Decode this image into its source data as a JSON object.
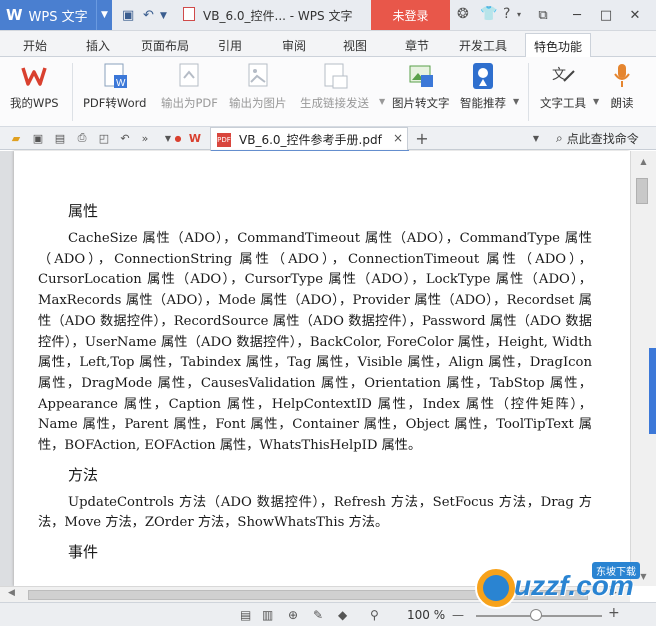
{
  "app": {
    "logo": "W",
    "name": "WPS 文字",
    "dropdown": "▼"
  },
  "window": {
    "title": "VB_6.0_控件... - WPS 文字",
    "login": "未登录",
    "controls": {
      "restore": "⧉",
      "minimize": "─",
      "maximize": "□",
      "close": "✕"
    }
  },
  "tabs": [
    "开始",
    "插入",
    "页面布局",
    "引用",
    "审阅",
    "视图",
    "章节",
    "开发工具",
    "特色功能"
  ],
  "active_tab": "特色功能",
  "ribbon": {
    "my_wps": "我的WPS",
    "pdf_to_word": "PDF转Word",
    "export_pdf": "输出为PDF",
    "export_image": "输出为图片",
    "gen_link": "生成链接发送",
    "image_to_text": "图片转文字",
    "smart_recommend": "智能推荐",
    "text_tools": "文字工具",
    "read_aloud": "朗读"
  },
  "doc_tab": {
    "name": "VB_6.0_控件参考手册.pdf",
    "close": "×",
    "add": "+"
  },
  "search_cmd": "点此查找命令",
  "document": {
    "sections": [
      {
        "heading": "属性",
        "text": "CacheSize 属性（ADO），CommandTimeout 属性（ADO），CommandType 属性（ADO），ConnectionString 属性（ADO），ConnectionTimeout 属性（ADO），CursorLocation 属性（ADO），CursorType 属性（ADO），LockType 属性（ADO），MaxRecords 属性（ADO），Mode 属性（ADO），Provider 属性（ADO），Recordset 属性（ADO 数据控件），RecordSource 属性（ADO 数据控件），Password 属性（ADO 数据控件），UserName 属性（ADO 数据控件），BackColor, ForeColor 属性，Height, Width 属性，Left,Top 属性，Tabindex 属性，Tag 属性，Visible 属性，Align 属性，DragIcon 属性，DragMode 属性，CausesValidation 属性，Orientation 属性，TabStop 属性，Appearance 属性，Caption 属性，HelpContextID 属性，Index 属性（控件矩阵），Name 属性，Parent 属性，Font 属性，Container 属性，Object 属性，ToolTipText 属性，BOFAction, EOFAction 属性，WhatsThisHelpID 属性。"
      },
      {
        "heading": "方法",
        "text": "UpdateControls 方法（ADO 数据控件），Refresh 方法，SetFocus 方法，Drag 方法，Move 方法，ZOrder 方法，ShowWhatsThis 方法。"
      },
      {
        "heading": "事件",
        "text": ""
      }
    ]
  },
  "status": {
    "zoom": "100 %",
    "minus": "—",
    "plus": "+"
  },
  "watermark": {
    "brand": "uzzf.com",
    "tagline": "东坡下载"
  }
}
